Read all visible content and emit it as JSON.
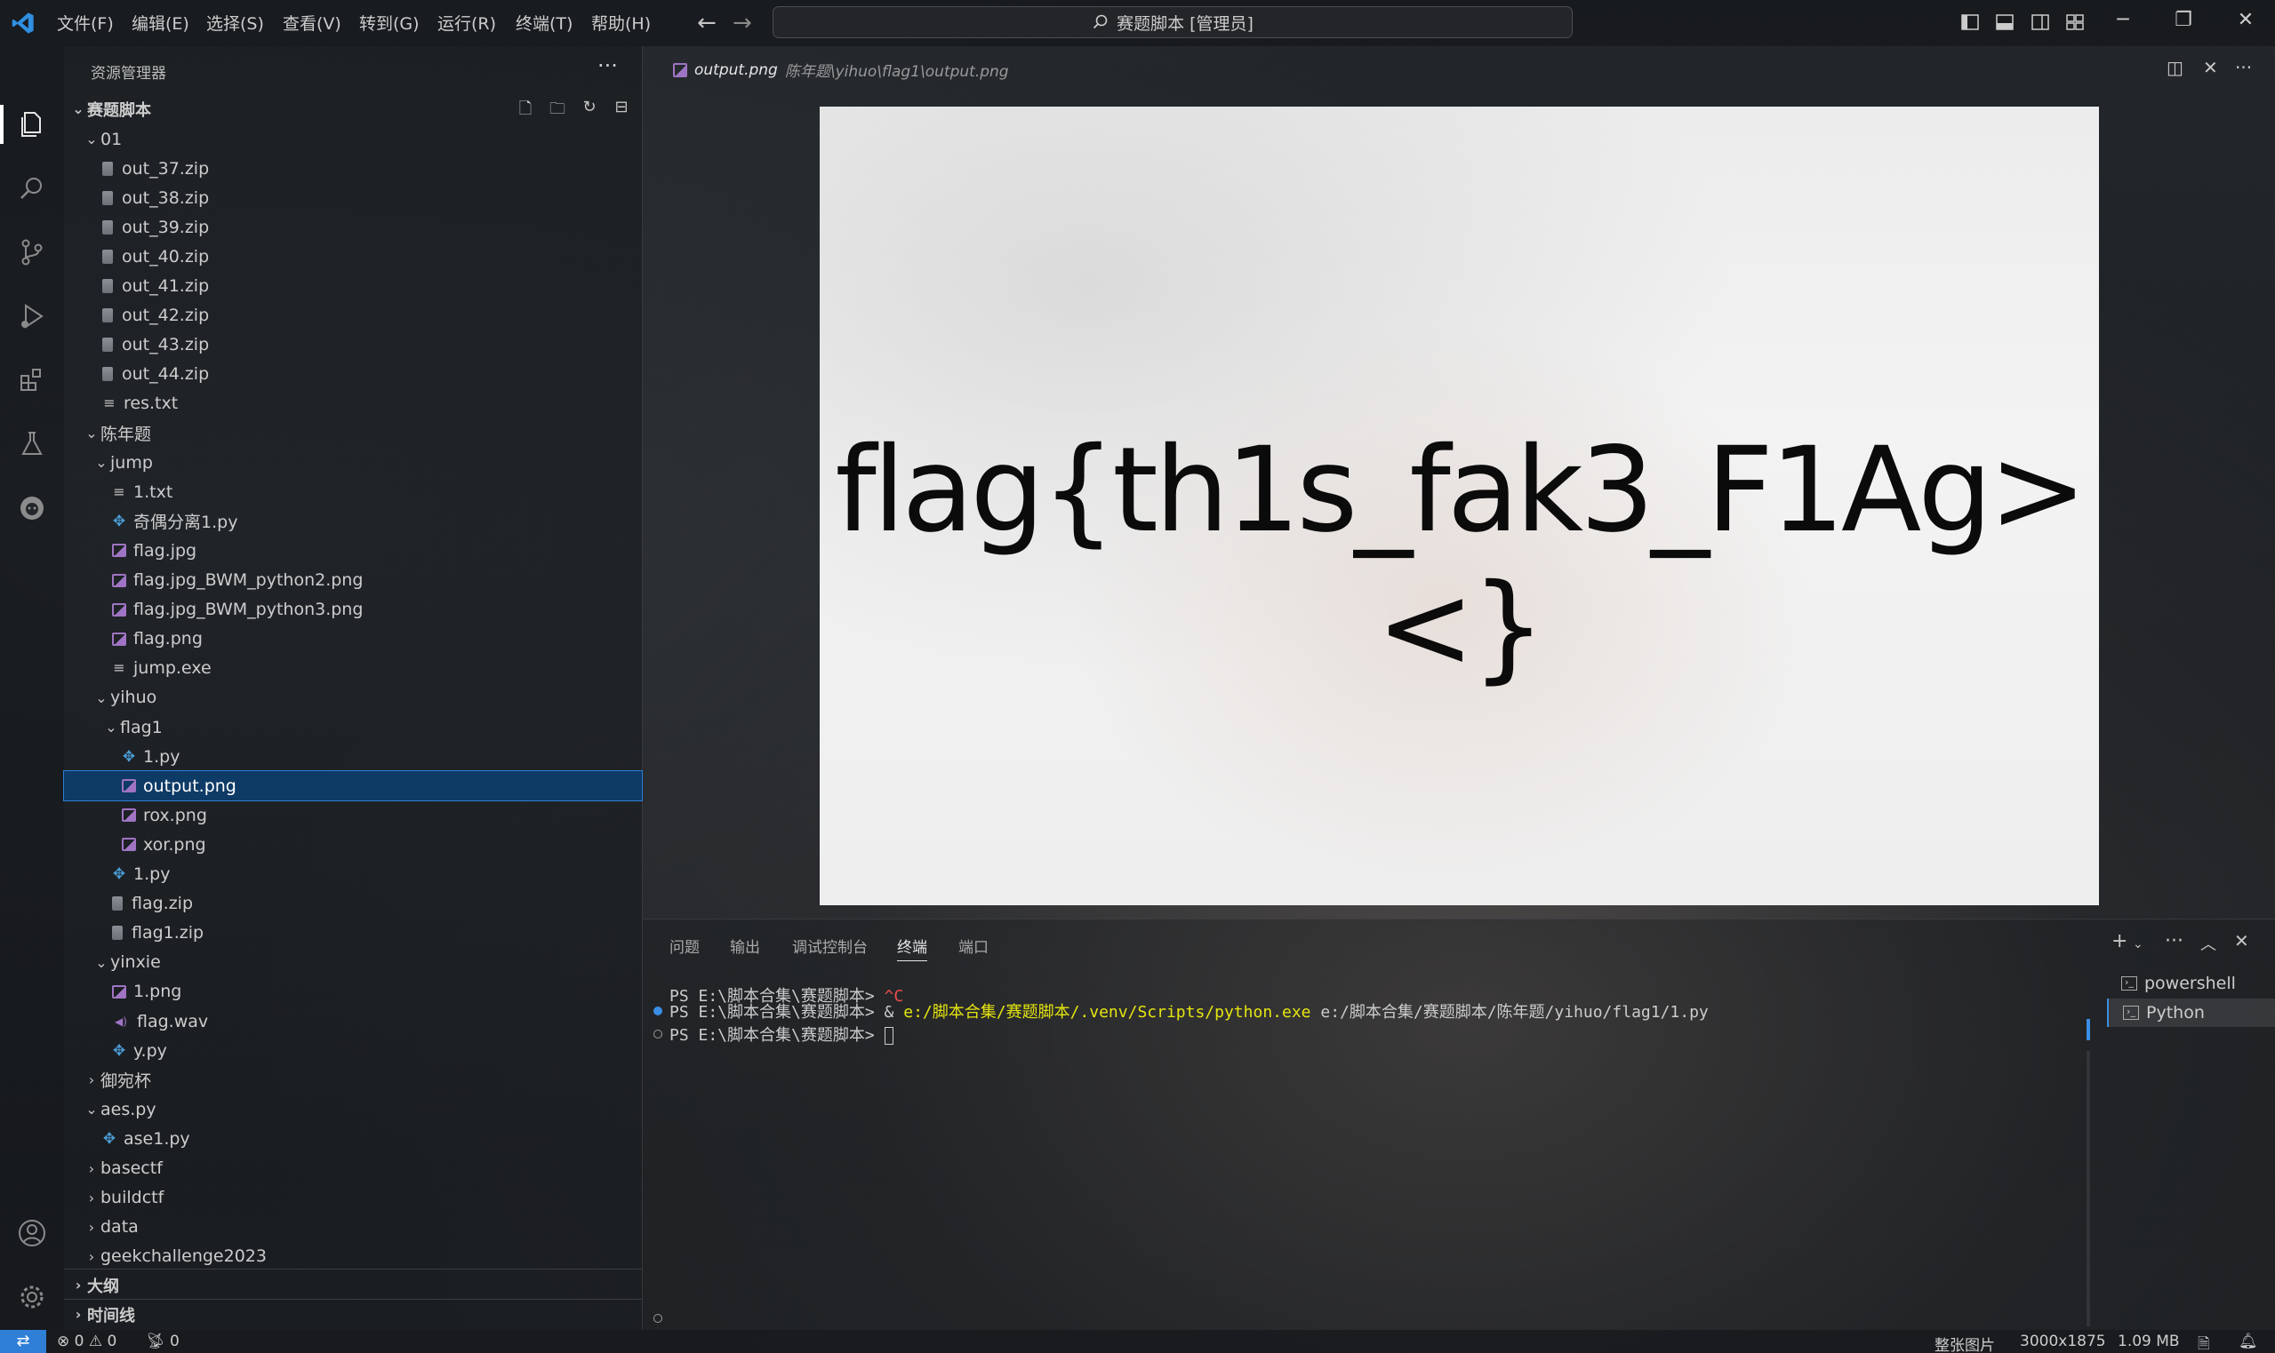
{
  "titlebar": {
    "menu": [
      "文件(F)",
      "编辑(E)",
      "选择(S)",
      "查看(V)",
      "转到(G)",
      "运行(R)",
      "终端(T)",
      "帮助(H)"
    ],
    "search_text": "赛题脚本 [管理员]"
  },
  "sidebar": {
    "title": "资源管理器",
    "root": "赛题脚本",
    "tree": [
      {
        "label": "01",
        "kind": "folder-open"
      },
      {
        "label": "out_37.zip",
        "kind": "zip"
      },
      {
        "label": "out_38.zip",
        "kind": "zip"
      },
      {
        "label": "out_39.zip",
        "kind": "zip"
      },
      {
        "label": "out_40.zip",
        "kind": "zip"
      },
      {
        "label": "out_41.zip",
        "kind": "zip"
      },
      {
        "label": "out_42.zip",
        "kind": "zip"
      },
      {
        "label": "out_43.zip",
        "kind": "zip"
      },
      {
        "label": "out_44.zip",
        "kind": "zip"
      },
      {
        "label": "res.txt",
        "kind": "txt"
      },
      {
        "label": "陈年题",
        "kind": "folder-open"
      },
      {
        "label": "jump",
        "kind": "folder-open"
      },
      {
        "label": "1.txt",
        "kind": "txt"
      },
      {
        "label": "奇偶分离1.py",
        "kind": "py"
      },
      {
        "label": "flag.jpg",
        "kind": "img"
      },
      {
        "label": "flag.jpg_BWM_python2.png",
        "kind": "img"
      },
      {
        "label": "flag.jpg_BWM_python3.png",
        "kind": "img"
      },
      {
        "label": "flag.png",
        "kind": "img"
      },
      {
        "label": "jump.exe",
        "kind": "txt"
      },
      {
        "label": "yihuo",
        "kind": "folder-open"
      },
      {
        "label": "flag1",
        "kind": "folder-open"
      },
      {
        "label": "1.py",
        "kind": "py"
      },
      {
        "label": "output.png",
        "kind": "img",
        "selected": true
      },
      {
        "label": "rox.png",
        "kind": "img"
      },
      {
        "label": "xor.png",
        "kind": "img"
      },
      {
        "label": "1.py",
        "kind": "py"
      },
      {
        "label": "flag.zip",
        "kind": "zip"
      },
      {
        "label": "flag1.zip",
        "kind": "zip"
      },
      {
        "label": "yinxie",
        "kind": "folder-open"
      },
      {
        "label": "1.png",
        "kind": "img"
      },
      {
        "label": "flag.wav",
        "kind": "wav"
      },
      {
        "label": "y.py",
        "kind": "py"
      },
      {
        "label": "御宛杯",
        "kind": "folder-closed"
      },
      {
        "label": "aes.py",
        "kind": "folder-open"
      },
      {
        "label": "ase1.py",
        "kind": "py"
      },
      {
        "label": "basectf",
        "kind": "folder-closed"
      },
      {
        "label": "buildctf",
        "kind": "folder-closed"
      },
      {
        "label": "data",
        "kind": "folder-closed"
      },
      {
        "label": "geekchallenge2023",
        "kind": "folder-closed"
      }
    ],
    "outline": "大纲",
    "timeline": "时间线"
  },
  "editor": {
    "tab_name": "output.png",
    "tab_path": "陈年题\\yihuo\\flag1\\output.png",
    "image_text": "flag{th1s_fak3_F1Ag><}"
  },
  "panel": {
    "tabs": [
      "问题",
      "输出",
      "调试控制台",
      "终端",
      "端口"
    ],
    "active_tab": "终端",
    "terminal": [
      {
        "prompt": "PS E:\\脚本合集\\赛题脚本> ",
        "cmd": "^C",
        "cmd_color": "#f14c4c"
      },
      {
        "prompt": "PS E:\\脚本合集\\赛题脚本> ",
        "amp": "& ",
        "exe": "e:/脚本合集/赛题脚本/.venv/Scripts/python.exe",
        "arg": " e:/脚本合集/赛题脚本/陈年题/yihuo/flag1/1.py"
      },
      {
        "prompt": "PS E:\\脚本合集\\赛题脚本> ",
        "cursor": true
      }
    ],
    "terminals": [
      "powershell",
      "Python"
    ]
  },
  "statusbar": {
    "errors": "0",
    "warnings": "0",
    "ports": "0",
    "mode": "整张图片",
    "dims": "3000x1875",
    "size": "1.09 MB"
  }
}
